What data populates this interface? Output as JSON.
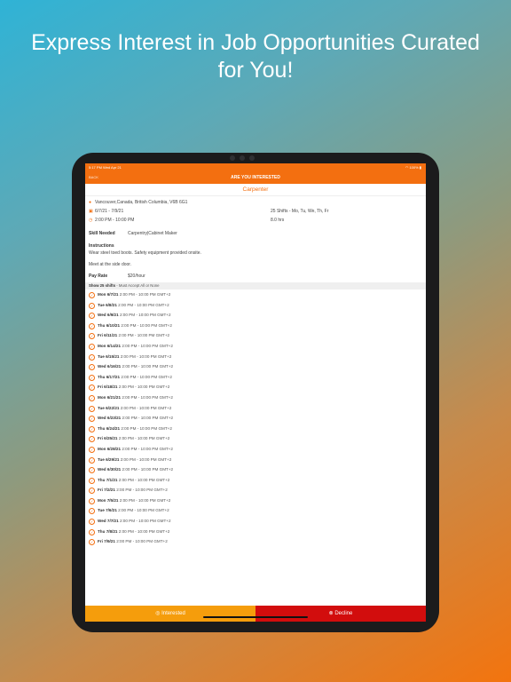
{
  "headline": "Express Interest in Job Opportunities Curated for You!",
  "status_bar": {
    "time": "5:17 PM  Wed Apr 21",
    "battery": "100%"
  },
  "nav": {
    "back": "BACK",
    "title": "ARE YOU INTERESTED"
  },
  "job": {
    "title": "Carpenter",
    "location": "Vancouver,Canada, British Columbia, V6B 6G1",
    "dates": "6/7/21 - 7/9/21",
    "shift_days": "25 Shifts - Mo, Tu, We, Th, Fr",
    "time": "2:00 PM - 10:00 PM",
    "hours": "8.0 hrs",
    "skill_label": "Skill Needed",
    "skill_value": "Carpentry|Cabinet Maker",
    "instructions_label": "Instructions",
    "instructions_line1": "Wear steel toed boots.  Safety equipment provided onsite.",
    "instructions_line2": "Meet at the side door.",
    "pay_label": "Pay Rate",
    "pay_value": "$20/hour"
  },
  "shifts_header": {
    "count": "Show 25 shifts",
    "note": " - Must Accept All or None"
  },
  "shift_time": "2:00 PM - 10:00 PM GMT+2",
  "shifts": [
    "Mon 6/7/21",
    "Tue 6/8/21",
    "Wed 6/9/21",
    "Thu 6/10/21",
    "Fri 6/11/21",
    "Mon 6/14/21",
    "Tue 6/15/21",
    "Wed 6/16/21",
    "Thu 6/17/21",
    "Fri 6/18/21",
    "Mon 6/21/21",
    "Tue 6/22/21",
    "Wed 6/23/21",
    "Thu 6/24/21",
    "Fri 6/25/21",
    "Mon 6/28/21",
    "Tue 6/29/21",
    "Wed 6/30/21",
    "Thu 7/1/21",
    "Fri 7/2/21",
    "Mon 7/5/21",
    "Tue 7/6/21",
    "Wed 7/7/21",
    "Thu 7/8/21",
    "Fri 7/9/21"
  ],
  "buttons": {
    "interested": "Interested",
    "decline": "Decline"
  },
  "colors": {
    "accent": "#f36f10",
    "interested": "#f59d0c",
    "decline": "#d20d0d"
  }
}
